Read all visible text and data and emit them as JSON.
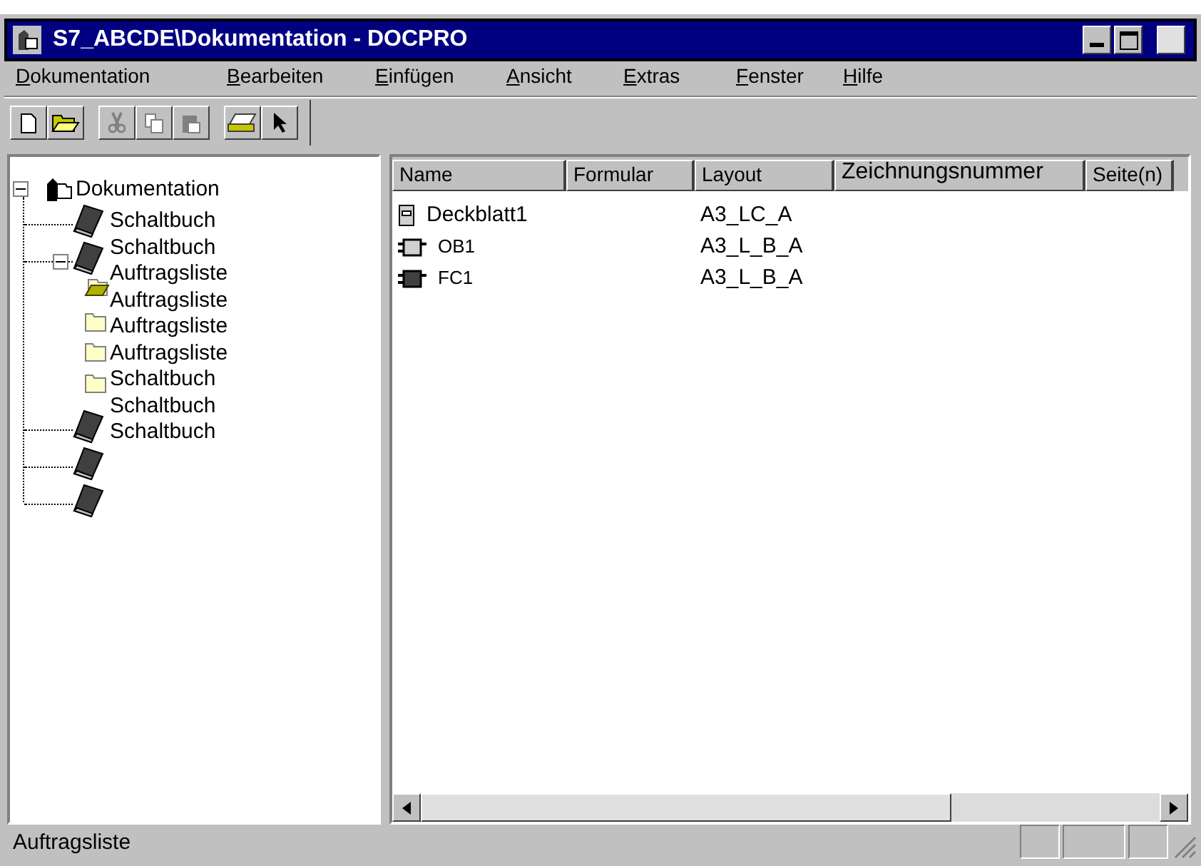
{
  "window": {
    "title": "S7_ABCDE\\Dokumentation - DOCPRO"
  },
  "menu": [
    "Dokumentation",
    "Bearbeiten",
    "Einfügen",
    "Ansicht",
    "Extras",
    "Fenster",
    "Hilfe"
  ],
  "toolbar": [
    {
      "kind": "new",
      "disabled": false
    },
    {
      "kind": "open",
      "disabled": false
    },
    {
      "kind": "cut",
      "disabled": true
    },
    {
      "kind": "copy",
      "disabled": true
    },
    {
      "kind": "paste",
      "disabled": true
    },
    {
      "kind": "print",
      "disabled": false
    },
    {
      "kind": "pointer",
      "disabled": false
    }
  ],
  "tree": {
    "label": "Dokumentation",
    "expanded": true,
    "children": [
      {
        "kind": "book"
      },
      {
        "kind": "book",
        "expanded": true,
        "children": [
          {
            "kind": "folder",
            "selected": true
          },
          {
            "kind": "folder",
            "selected": false
          },
          {
            "kind": "folder",
            "selected": false
          },
          {
            "kind": "folder",
            "selected": false
          }
        ]
      },
      {
        "kind": "book"
      },
      {
        "kind": "book"
      },
      {
        "kind": "book"
      }
    ]
  },
  "tree_labels": [
    "Schaltbuch",
    "Schaltbuch",
    "Auftragsliste",
    "Auftragsliste",
    "Auftragsliste",
    "Auftragsliste",
    "Schaltbuch",
    "Schaltbuch",
    "Schaltbuch"
  ],
  "table": {
    "columns": [
      "Name",
      "Formular",
      "Layout",
      "Zeichnungsnummer",
      "Seite(n)"
    ],
    "rows": [
      {
        "kind": "cover",
        "name": "Deckblatt1",
        "layout": "A3_LC_A"
      },
      {
        "kind": "block",
        "name": "OB1",
        "layout": "A3_L_B_A"
      },
      {
        "kind": "block-dark",
        "name": "FC1",
        "layout": "A3_L_B_A"
      }
    ]
  },
  "status_bar": {
    "text": "Auftragsliste"
  }
}
